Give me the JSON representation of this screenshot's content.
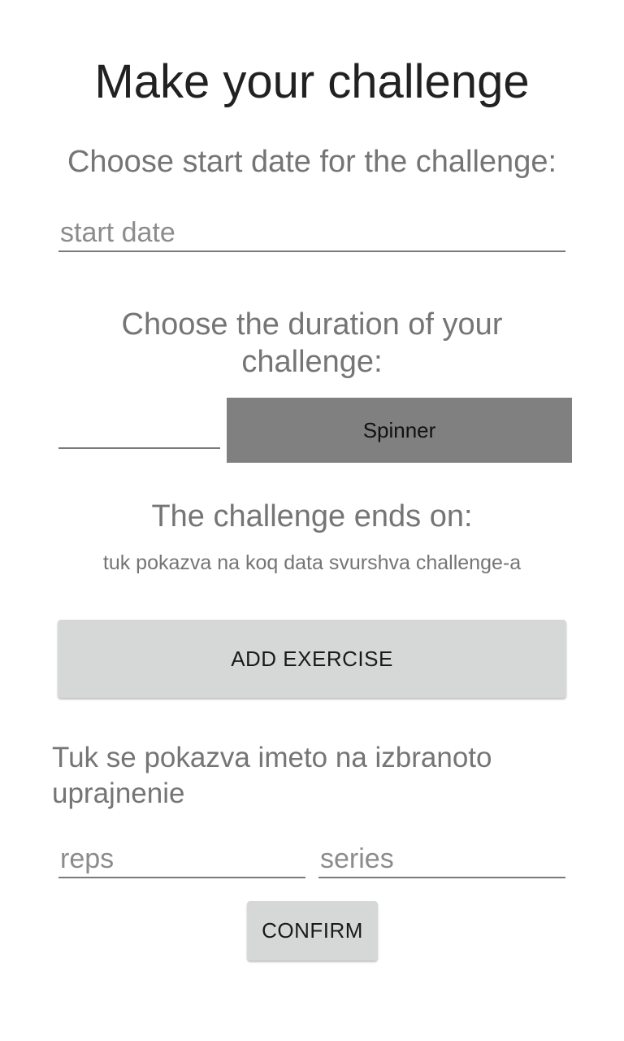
{
  "header": {
    "title": "Make your challenge"
  },
  "start": {
    "label": "Choose start date for the challenge:",
    "placeholder": "start date",
    "value": ""
  },
  "duration": {
    "label": "Choose the duration of your challenge:",
    "value": "",
    "spinner_text": "Spinner"
  },
  "end": {
    "label": "The challenge ends on:",
    "text": "tuk pokazva na koq data svurshva challenge-a"
  },
  "exercise": {
    "add_button": "ADD EXERCISE",
    "name_text": "Tuk se pokazva imeto na izbranoto uprajnenie",
    "reps_placeholder": "reps",
    "series_placeholder": "series",
    "confirm_button": "CONFIRM"
  }
}
